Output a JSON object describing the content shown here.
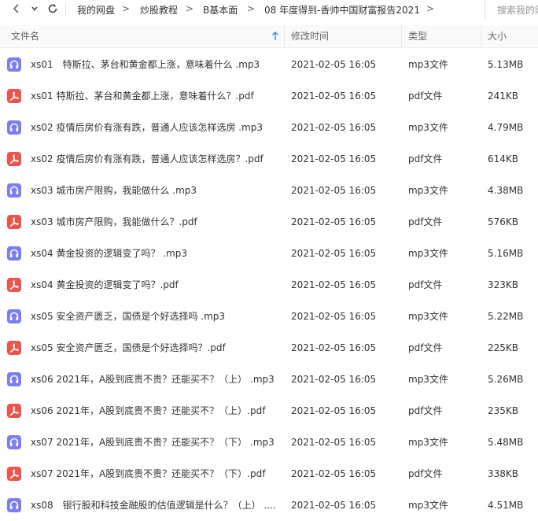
{
  "toolbar": {
    "back_icon": "chevron-left-icon",
    "forward_icon": "chevron-down-icon",
    "refresh_icon": "refresh-icon",
    "breadcrumb": [
      "我的网盘",
      "炒股教程",
      "B基本面",
      "08 年度得到-香帅中国财富报告2021"
    ],
    "search_placeholder": "搜索我的网盘文件"
  },
  "columns": {
    "name": "文件名",
    "modified": "修改时间",
    "type": "类型",
    "size": "大小"
  },
  "files": [
    {
      "kind": "mp3",
      "name": "xs01　特斯拉、茅台和黄金都上涨，意味着什么 .mp3",
      "modified": "2021-02-05 16:05",
      "type": "mp3文件",
      "size": "5.13MB"
    },
    {
      "kind": "pdf",
      "name": "xs01 特斯拉、茅台和黄金都上涨，意味着什么？.pdf",
      "modified": "2021-02-05 16:05",
      "type": "pdf文件",
      "size": "241KB"
    },
    {
      "kind": "mp3",
      "name": "xs02 疫情后房价有涨有跌，普通人应该怎样选房 .mp3",
      "modified": "2021-02-05 16:05",
      "type": "mp3文件",
      "size": "4.79MB"
    },
    {
      "kind": "pdf",
      "name": "xs02 疫情后房价有涨有跌，普通人应该怎样选房？.pdf",
      "modified": "2021-02-05 16:05",
      "type": "pdf文件",
      "size": "614KB"
    },
    {
      "kind": "mp3",
      "name": "xs03 城市房产限购，我能做什么 .mp3",
      "modified": "2021-02-05 16:05",
      "type": "mp3文件",
      "size": "4.38MB"
    },
    {
      "kind": "pdf",
      "name": "xs03 城市房产限购，我能做什么？.pdf",
      "modified": "2021-02-05 16:05",
      "type": "pdf文件",
      "size": "576KB"
    },
    {
      "kind": "mp3",
      "name": "xs04 黄金投资的逻辑变了吗？ .mp3",
      "modified": "2021-02-05 16:05",
      "type": "mp3文件",
      "size": "5.16MB"
    },
    {
      "kind": "pdf",
      "name": "xs04 黄金投资的逻辑变了吗？.pdf",
      "modified": "2021-02-05 16:05",
      "type": "pdf文件",
      "size": "323KB"
    },
    {
      "kind": "mp3",
      "name": "xs05 安全资产匮乏，国债是个好选择吗 .mp3",
      "modified": "2021-02-05 16:05",
      "type": "mp3文件",
      "size": "5.22MB"
    },
    {
      "kind": "pdf",
      "name": "xs05 安全资产匮乏，国债是个好选择吗？.pdf",
      "modified": "2021-02-05 16:05",
      "type": "pdf文件",
      "size": "225KB"
    },
    {
      "kind": "mp3",
      "name": "xs06 2021年，A股到底贵不贵？还能买不？（上） .mp3",
      "modified": "2021-02-05 16:05",
      "type": "mp3文件",
      "size": "5.26MB"
    },
    {
      "kind": "pdf",
      "name": "xs06 2021年，A股到底贵不贵？还能买不？（上）.pdf",
      "modified": "2021-02-05 16:05",
      "type": "pdf文件",
      "size": "235KB"
    },
    {
      "kind": "mp3",
      "name": "xs07 2021年，A股到底贵不贵？还能买不？（下） .mp3",
      "modified": "2021-02-05 16:05",
      "type": "mp3文件",
      "size": "5.48MB"
    },
    {
      "kind": "pdf",
      "name": "xs07 2021年，A股到底贵不贵？还能买不？（下）.pdf",
      "modified": "2021-02-05 16:05",
      "type": "pdf文件",
      "size": "338KB"
    },
    {
      "kind": "mp3",
      "name": "xs08　银行股和科技金融股的估值逻辑是什么？（上） ....",
      "modified": "2021-02-05 16:05",
      "type": "mp3文件",
      "size": "4.51MB"
    }
  ]
}
